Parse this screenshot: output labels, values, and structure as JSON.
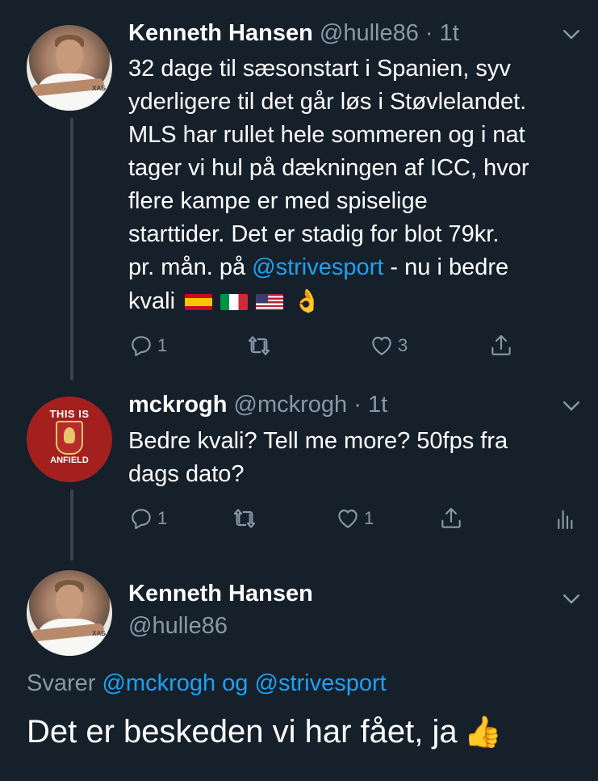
{
  "tweet1": {
    "name": "Kenneth Hansen",
    "handle": "@hulle86",
    "dot": "·",
    "time": "1t",
    "lines": [
      "32 dage til sæsonstart i Spanien, syv",
      "yderligere til det går løs i Støvlelandet.",
      "MLS har rullet hele sommeren og i nat",
      "tager vi hul på dækningen af ICC, hvor",
      "flere kampe er med spiselige",
      "starttider. Det er stadig for blot 79kr."
    ],
    "line7_before": "pr. mån. på ",
    "line7_mention": "@strivesport",
    "line7_after": " - nu i bedre",
    "line8_text": "kvali",
    "flags": [
      "flag-es",
      "flag-it",
      "flag-us"
    ],
    "ok_emoji": "👌",
    "reply_count": "1",
    "retweet_count": "",
    "like_count": "3"
  },
  "tweet2": {
    "name": "mckrogh",
    "handle": "@mckrogh",
    "dot": "·",
    "time": "1t",
    "lines": [
      "Bedre kvali? Tell me more? 50fps fra",
      "dags dato?"
    ],
    "avatar_top": "THIS IS",
    "avatar_bottom": "ANFIELD",
    "reply_count": "1",
    "retweet_count": "",
    "like_count": "1"
  },
  "tweet3": {
    "name": "Kenneth Hansen",
    "handle": "@hulle86",
    "reply_prefix": "Svarer ",
    "reply_mention1": "@mckrogh",
    "reply_og": " og ",
    "reply_mention2": "@strivesport",
    "text": "Det er beskeden vi har fået, ja",
    "thumb_emoji": "👍"
  },
  "icons": {
    "reply": "reply-icon",
    "retweet": "retweet-icon",
    "like": "heart-icon",
    "share": "share-icon",
    "analytics": "analytics-icon",
    "chevron": "chevron-down-icon"
  },
  "colors": {
    "background": "#15202b",
    "secondary_text": "#8899a6",
    "link": "#1da1f2",
    "thread_line": "#38444d"
  }
}
